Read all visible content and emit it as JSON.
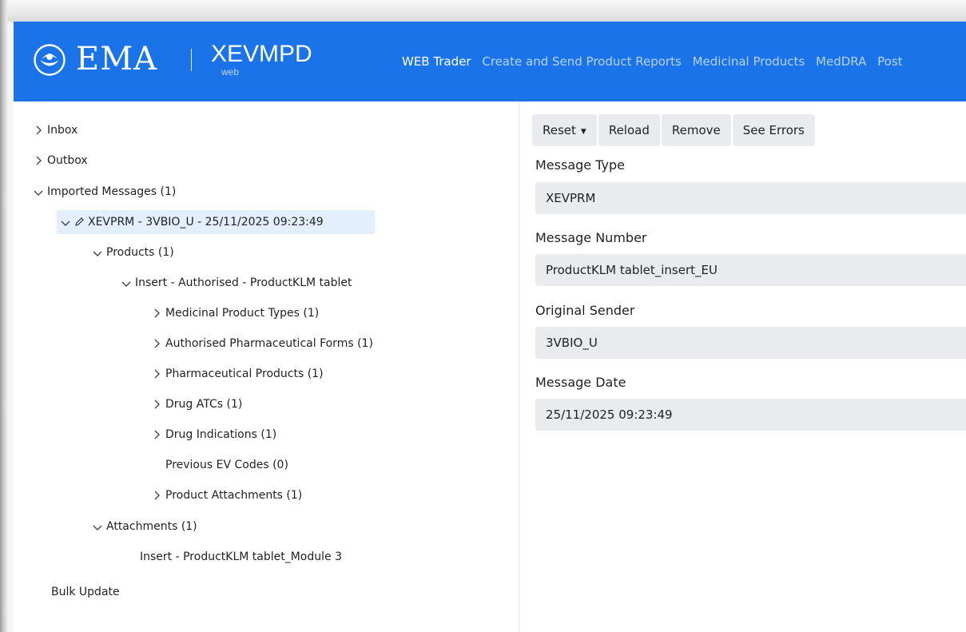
{
  "header": {
    "brand": "EMA",
    "product_name": "XEVMPD",
    "product_sub": "web",
    "nav": [
      {
        "label": "WEB Trader",
        "active": true
      },
      {
        "label": "Create and Send Product Reports",
        "active": false
      },
      {
        "label": "Medicinal Products",
        "active": false
      },
      {
        "label": "MedDRA",
        "active": false
      },
      {
        "label": "Post",
        "active": false
      }
    ]
  },
  "tree": {
    "inbox": "Inbox",
    "outbox": "Outbox",
    "imported": "Imported Messages (1)",
    "message": "XEVPRM - 3VBIO_U - 25/11/2025 09:23:49",
    "products": "Products (1)",
    "insert": "Insert - Authorised - ProductKLM tablet",
    "medicinal_product_types": "Medicinal Product Types (1)",
    "authorised_forms": "Authorised Pharmaceutical Forms (1)",
    "pharmaceutical_products": "Pharmaceutical Products (1)",
    "drug_atcs": "Drug ATCs (1)",
    "drug_indications": "Drug Indications (1)",
    "previous_ev_codes": "Previous EV Codes (0)",
    "product_attachments": "Product Attachments (1)",
    "attachments": "Attachments (1)",
    "attachment_item": "Insert - ProductKLM tablet_Module 3",
    "bulk_update": "Bulk Update"
  },
  "toolbar": {
    "reset": "Reset",
    "reload": "Reload",
    "remove": "Remove",
    "see_errors": "See Errors"
  },
  "form": {
    "message_type_label": "Message Type",
    "message_type_value": "XEVPRM",
    "message_number_label": "Message Number",
    "message_number_value": "ProductKLM tablet_insert_EU",
    "original_sender_label": "Original Sender",
    "original_sender_value": "3VBIO_U",
    "message_date_label": "Message Date",
    "message_date_value": "25/11/2025 09:23:49"
  },
  "colors": {
    "header_bg": "#1a73e8",
    "selected_bg": "#e3effc",
    "button_bg": "#e9ebee"
  }
}
